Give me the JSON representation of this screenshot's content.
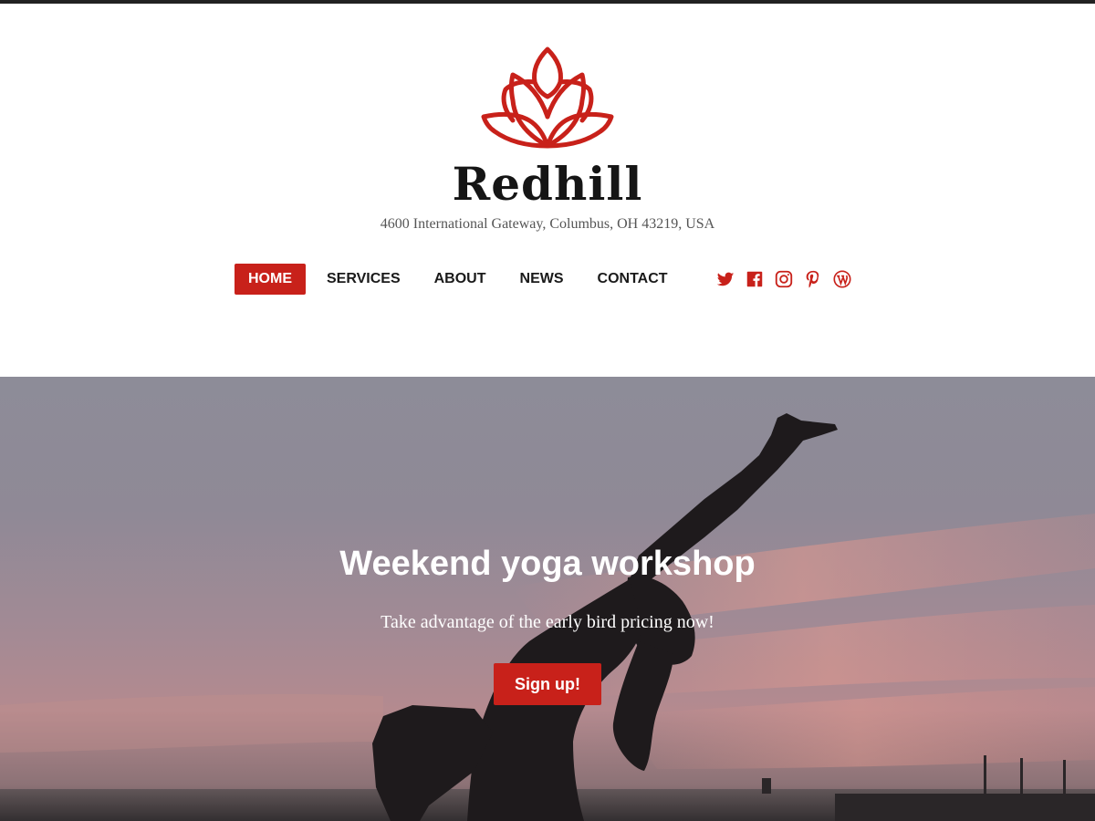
{
  "site": {
    "title": "Redhill",
    "address": "4600 International Gateway, Columbus, OH 43219, USA"
  },
  "nav": {
    "items": [
      {
        "label": "HOME",
        "active": true
      },
      {
        "label": "SERVICES",
        "active": false
      },
      {
        "label": "ABOUT",
        "active": false
      },
      {
        "label": "NEWS",
        "active": false
      },
      {
        "label": "CONTACT",
        "active": false
      }
    ]
  },
  "social": {
    "icons": [
      "twitter-icon",
      "facebook-icon",
      "instagram-icon",
      "pinterest-icon",
      "wordpress-icon"
    ]
  },
  "hero": {
    "title": "Weekend yoga workshop",
    "subtitle": "Take advantage of the early bird pricing now!",
    "button_label": "Sign up!"
  },
  "colors": {
    "accent": "#c8211a",
    "title": "#151515",
    "text": "#1a1a1a"
  },
  "icons": {
    "logo": "lotus-logo-icon"
  }
}
